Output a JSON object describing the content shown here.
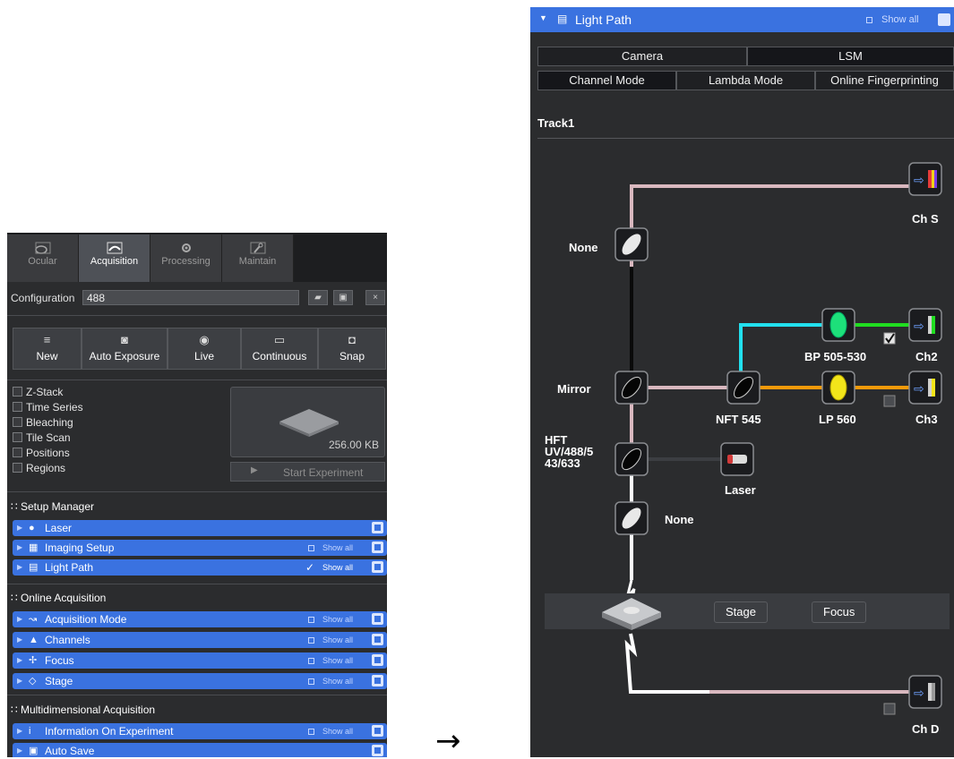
{
  "tabs": [
    {
      "label": "Ocular",
      "icon": "ocular-icon"
    },
    {
      "label": "Acquisition",
      "icon": "acquisition-icon",
      "active": true
    },
    {
      "label": "Processing",
      "icon": "gear-icon"
    },
    {
      "label": "Maintain",
      "icon": "wrench-icon"
    }
  ],
  "config": {
    "label": "Configuration",
    "value": "488",
    "close": "×"
  },
  "buttons": [
    {
      "label": "New",
      "icon": "list-icon"
    },
    {
      "label": "Auto Exposure",
      "icon": "camera-icon"
    },
    {
      "label": "Live",
      "icon": "eye-icon"
    },
    {
      "label": "Continuous",
      "icon": "video-icon"
    },
    {
      "label": "Snap",
      "icon": "snapshot-icon"
    }
  ],
  "options": [
    "Z-Stack",
    "Time Series",
    "Bleaching",
    "Tile Scan",
    "Positions",
    "Regions"
  ],
  "preview": {
    "size": "256.00 KB",
    "start": "Start Experiment"
  },
  "sections": [
    {
      "title": "Setup Manager",
      "items": [
        {
          "label": "Laser",
          "icon": "bulb-icon",
          "show_all": "",
          "checked": false
        },
        {
          "label": "Imaging Setup",
          "icon": "grid-icon",
          "show_all": "Show all",
          "checked": false
        },
        {
          "label": "Light Path",
          "icon": "lightpath-icon",
          "show_all": "Show all",
          "checked": true
        }
      ]
    },
    {
      "title": "Online Acquisition",
      "items": [
        {
          "label": "Acquisition Mode",
          "icon": "mode-icon",
          "show_all": "Show all",
          "checked": false
        },
        {
          "label": "Channels",
          "icon": "channels-icon",
          "show_all": "Show all",
          "checked": false
        },
        {
          "label": "Focus",
          "icon": "focus-icon",
          "show_all": "Show all",
          "checked": false
        },
        {
          "label": "Stage",
          "icon": "stage-icon",
          "show_all": "Show all",
          "checked": false
        }
      ]
    },
    {
      "title": "Multidimensional Acquisition",
      "items": [
        {
          "label": "Information On Experiment",
          "icon": "info-icon",
          "show_all": "Show all",
          "checked": false
        },
        {
          "label": "Auto Save",
          "icon": "save-icon",
          "show_all": "",
          "checked": false
        }
      ]
    }
  ],
  "arrow": "→",
  "lightpath": {
    "title": "Light Path",
    "show_all": "Show all",
    "detector_tabs": [
      "Camera",
      "LSM"
    ],
    "mode_tabs": [
      "Channel Mode",
      "Lambda Mode",
      "Online Fingerprinting"
    ],
    "track": "Track1",
    "labels": {
      "none_top": "None",
      "mirror": "Mirror",
      "hft": "HFT\nUV/488/5\n43/633",
      "none_bottom": "None",
      "nft": "NFT 545",
      "bp": "BP 505-530",
      "lp": "LP 560",
      "laser": "Laser",
      "chs": "Ch S",
      "ch2": "Ch2",
      "ch3": "Ch3",
      "chd": "Ch D"
    },
    "stage_button": "Stage",
    "focus_button": "Focus",
    "colors": {
      "beam": "#d9b8bf",
      "cyan": "#22e0ee",
      "green": "#20dd20",
      "orange": "#f59a0a",
      "yellow": "#f2e51a"
    }
  }
}
